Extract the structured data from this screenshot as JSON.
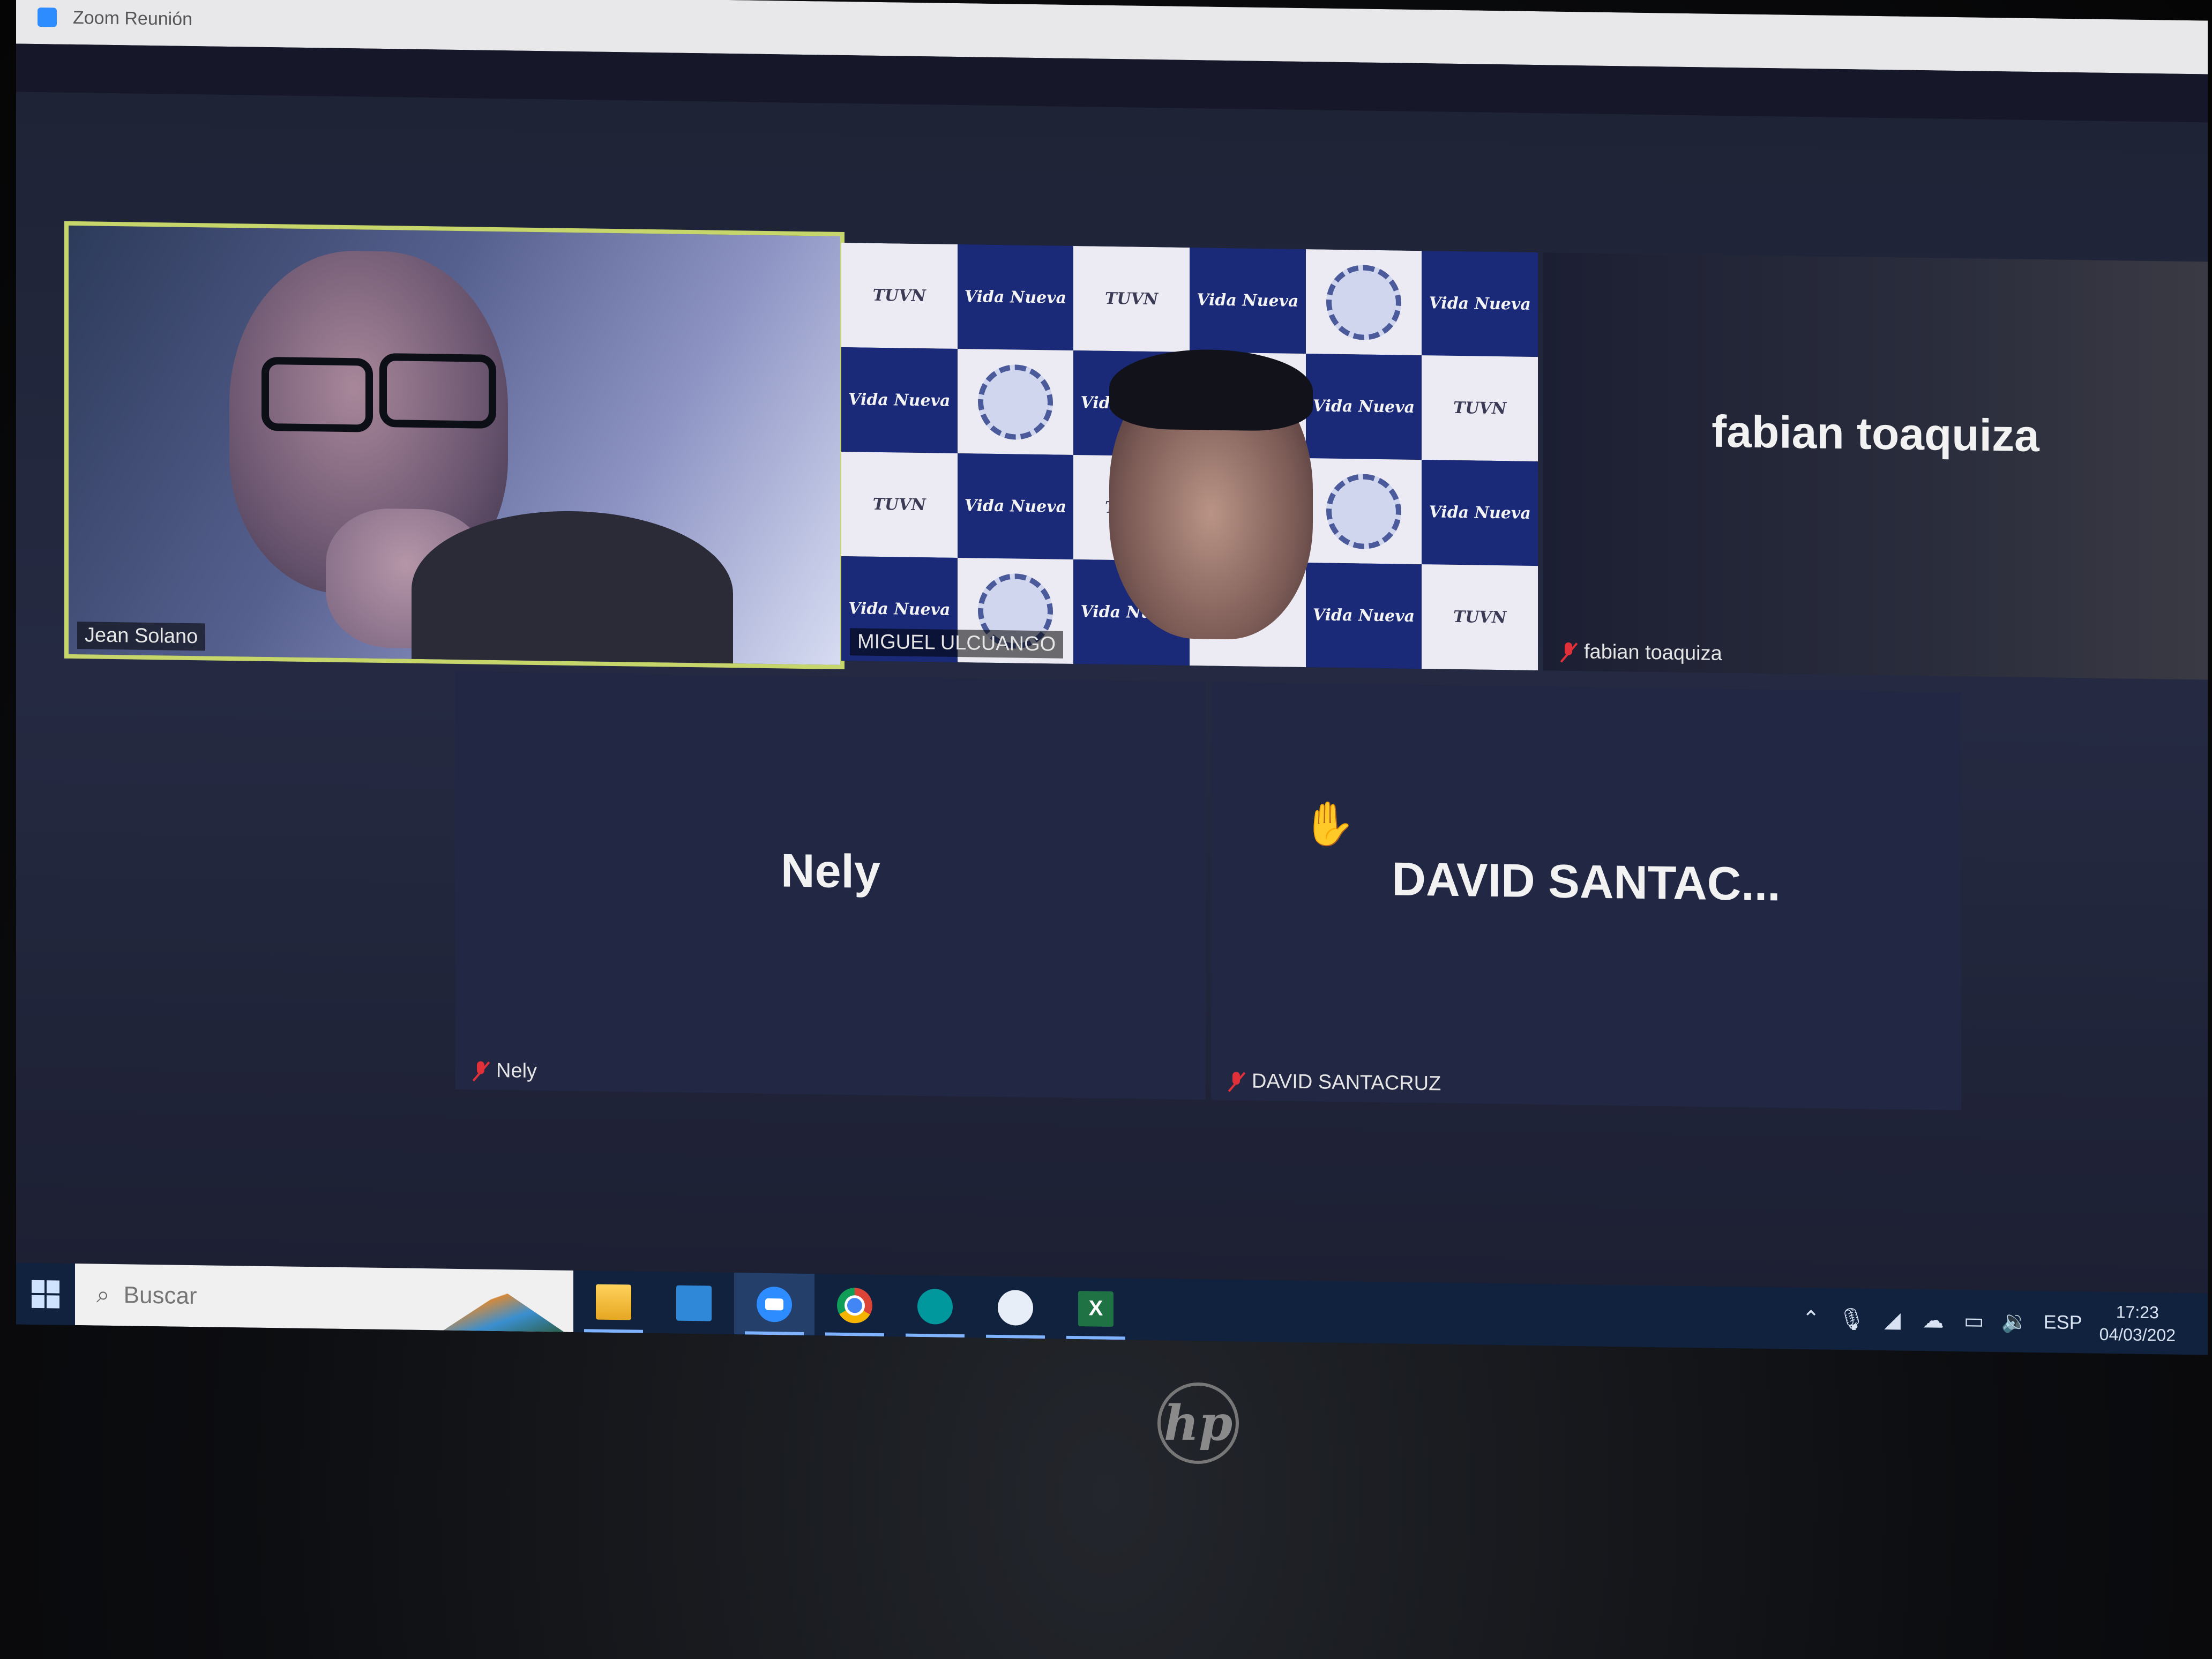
{
  "window": {
    "title": "Zoom Reunión",
    "subheader_text": ""
  },
  "participants": {
    "jean": {
      "tag": "Jean Solano"
    },
    "miguel": {
      "tag": "MIGUEL ULCUANGO",
      "backdrop_text": "Vida Nueva",
      "backdrop_logo": "TUVN"
    },
    "fabian": {
      "big_name": "fabian toaquiza",
      "tag": "fabian toaquiza"
    },
    "nely": {
      "big_name": "Nely",
      "tag": "Nely"
    },
    "david": {
      "big_name": "DAVID SANTAC...",
      "tag": "DAVID SANTACRUZ"
    }
  },
  "taskbar": {
    "search_placeholder": "Buscar",
    "excel_label": "X",
    "tray": {
      "language": "ESP",
      "time": "17:23",
      "date": "04/03/202"
    }
  },
  "device": {
    "brand_logo": "hp"
  },
  "colors": {
    "active_speaker_border": "#c7d66a",
    "taskbar_bg": "#10223e",
    "muted_red": "#e0303a"
  },
  "icons": [
    "windows-start-icon",
    "search-icon",
    "folder-icon",
    "this-pc-icon",
    "zoom-icon",
    "chrome-icon",
    "arduino-icon",
    "app-icon",
    "excel-icon",
    "chevron-up-icon",
    "microphone-icon",
    "network-icon",
    "cloud-icon",
    "battery-icon",
    "volume-icon",
    "muted-mic-icon",
    "raise-hand-cursor-icon"
  ]
}
